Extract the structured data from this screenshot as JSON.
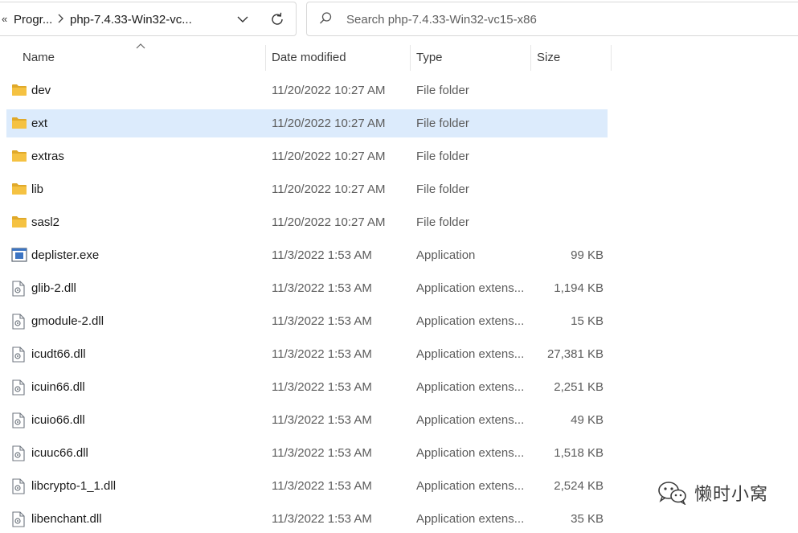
{
  "address_bar": {
    "overflow_glyph": "«",
    "crumbs": [
      "Progr...",
      "php-7.4.33-Win32-vc..."
    ],
    "dropdown_icon": "chevron-down-icon",
    "refresh_icon": "refresh-icon"
  },
  "search": {
    "placeholder": "Search php-7.4.33-Win32-vc15-x86",
    "icon": "search-icon"
  },
  "columns": {
    "name": "Name",
    "date": "Date modified",
    "type": "Type",
    "size": "Size"
  },
  "files": [
    {
      "name": "dev",
      "date": "11/20/2022 10:27 AM",
      "type": "File folder",
      "size": "",
      "kind": "folder"
    },
    {
      "name": "ext",
      "date": "11/20/2022 10:27 AM",
      "type": "File folder",
      "size": "",
      "kind": "folder",
      "selected": true
    },
    {
      "name": "extras",
      "date": "11/20/2022 10:27 AM",
      "type": "File folder",
      "size": "",
      "kind": "folder"
    },
    {
      "name": "lib",
      "date": "11/20/2022 10:27 AM",
      "type": "File folder",
      "size": "",
      "kind": "folder"
    },
    {
      "name": "sasl2",
      "date": "11/20/2022 10:27 AM",
      "type": "File folder",
      "size": "",
      "kind": "folder"
    },
    {
      "name": "deplister.exe",
      "date": "11/3/2022 1:53 AM",
      "type": "Application",
      "size": "99 KB",
      "kind": "exe"
    },
    {
      "name": "glib-2.dll",
      "date": "11/3/2022 1:53 AM",
      "type": "Application extens...",
      "size": "1,194 KB",
      "kind": "dll"
    },
    {
      "name": "gmodule-2.dll",
      "date": "11/3/2022 1:53 AM",
      "type": "Application extens...",
      "size": "15 KB",
      "kind": "dll"
    },
    {
      "name": "icudt66.dll",
      "date": "11/3/2022 1:53 AM",
      "type": "Application extens...",
      "size": "27,381 KB",
      "kind": "dll"
    },
    {
      "name": "icuin66.dll",
      "date": "11/3/2022 1:53 AM",
      "type": "Application extens...",
      "size": "2,251 KB",
      "kind": "dll"
    },
    {
      "name": "icuio66.dll",
      "date": "11/3/2022 1:53 AM",
      "type": "Application extens...",
      "size": "49 KB",
      "kind": "dll"
    },
    {
      "name": "icuuc66.dll",
      "date": "11/3/2022 1:53 AM",
      "type": "Application extens...",
      "size": "1,518 KB",
      "kind": "dll"
    },
    {
      "name": "libcrypto-1_1.dll",
      "date": "11/3/2022 1:53 AM",
      "type": "Application extens...",
      "size": "2,524 KB",
      "kind": "dll"
    },
    {
      "name": "libenchant.dll",
      "date": "11/3/2022 1:53 AM",
      "type": "Application extens...",
      "size": "35 KB",
      "kind": "dll"
    }
  ],
  "watermark": {
    "text": "懒时小窝",
    "icon": "wechat-icon"
  },
  "colors": {
    "selection": "#dcebfc",
    "folder": "#f5c242",
    "folder_dark": "#e0a92a"
  }
}
